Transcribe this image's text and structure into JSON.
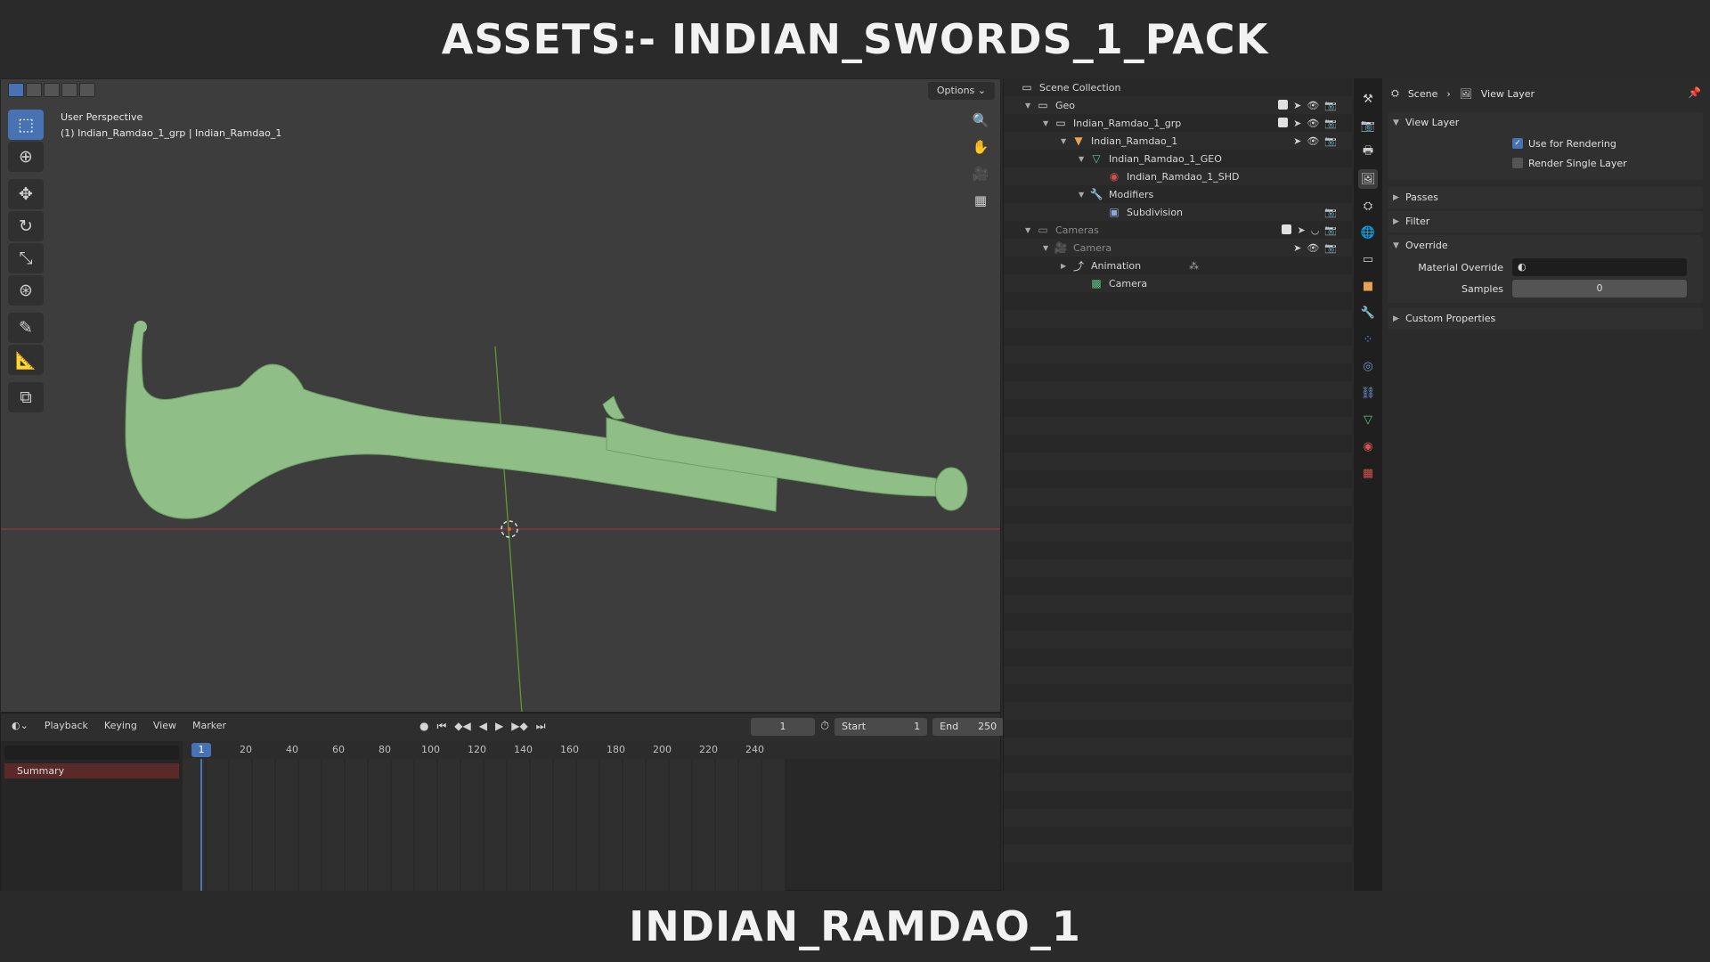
{
  "banner": {
    "top_title": "ASSETS:- INDIAN_SWORDS_1_PACK",
    "bottom_title": "INDIAN_RAMDAO_1"
  },
  "viewport": {
    "options_label": "Options",
    "perspective_label": "User Perspective",
    "object_label": "(1) Indian_Ramdao_1_grp | Indian_Ramdao_1",
    "tools": [
      "select-box-tool",
      "cursor-tool",
      "move-tool",
      "rotate-tool",
      "scale-tool",
      "transform-tool",
      "annotate-tool",
      "measure-tool",
      "add-cube-tool"
    ],
    "mesh_color": "#8fbf86",
    "x_axis_color": "#a8353d",
    "y_axis_color": "#5f9a32"
  },
  "timeline": {
    "menu": [
      "Playback",
      "Keying",
      "View",
      "Marker"
    ],
    "current_frame": "1",
    "start_label": "Start",
    "start_value": "1",
    "end_label": "End",
    "end_value": "250",
    "ruler_current": "1",
    "ruler_ticks": [
      "20",
      "40",
      "60",
      "80",
      "100",
      "120",
      "140",
      "160",
      "180",
      "200",
      "220",
      "240"
    ],
    "summary_label": "Summary"
  },
  "outliner": {
    "rows": [
      {
        "label": "Scene Collection",
        "depth": 0,
        "icon": "collection-icon",
        "twisty": ""
      },
      {
        "label": "Geo",
        "depth": 1,
        "icon": "collection-icon",
        "twisty": "▼"
      },
      {
        "label": "Indian_Ramdao_1_grp",
        "depth": 2,
        "icon": "collection-icon",
        "twisty": "▼"
      },
      {
        "label": "Indian_Ramdao_1",
        "depth": 3,
        "icon": "mesh-object-icon",
        "twisty": "▼"
      },
      {
        "label": "Indian_Ramdao_1_GEO",
        "depth": 4,
        "icon": "mesh-data-icon",
        "twisty": "▼"
      },
      {
        "label": "Indian_Ramdao_1_SHD",
        "depth": 5,
        "icon": "material-icon",
        "twisty": ""
      },
      {
        "label": "Modifiers",
        "depth": 4,
        "icon": "wrench-icon",
        "twisty": "▼"
      },
      {
        "label": "Subdivision",
        "depth": 5,
        "icon": "subdivision-icon",
        "twisty": ""
      },
      {
        "label": "Cameras",
        "depth": 1,
        "icon": "collection-icon",
        "twisty": "▼"
      },
      {
        "label": "Camera",
        "depth": 2,
        "icon": "camera-object-icon",
        "twisty": "▼"
      },
      {
        "label": "Animation",
        "depth": 3,
        "icon": "animation-icon",
        "twisty": "▶"
      },
      {
        "label": "Camera",
        "depth": 4,
        "icon": "camera-data-icon",
        "twisty": ""
      }
    ]
  },
  "properties": {
    "breadcrumb_scene": "Scene",
    "breadcrumb_view_layer": "View Layer",
    "view_layer_panel": "View Layer",
    "use_for_rendering": "Use for Rendering",
    "render_single_layer": "Render Single Layer",
    "passes_panel": "Passes",
    "filter_panel": "Filter",
    "override_panel": "Override",
    "material_override_label": "Material Override",
    "samples_label": "Samples",
    "samples_value": "0",
    "custom_properties_panel": "Custom Properties"
  }
}
